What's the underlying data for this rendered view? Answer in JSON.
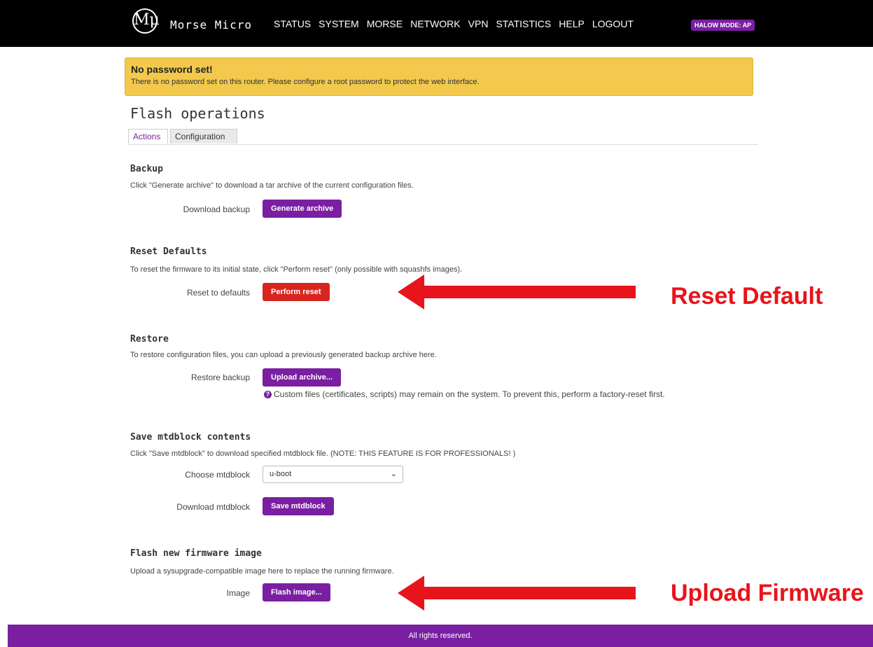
{
  "header": {
    "logo_glyph": "Mμ",
    "brand": "Morse Micro",
    "nav": [
      "STATUS",
      "SYSTEM",
      "MORSE",
      "NETWORK",
      "VPN",
      "STATISTICS",
      "HELP",
      "LOGOUT"
    ],
    "mode_badge": "HALOW MODE: AP"
  },
  "alert": {
    "title": "No password set!",
    "text": "There is no password set on this router. Please configure a root password to protect the web interface."
  },
  "page_title": "Flash operations",
  "tabs": [
    {
      "label": "Actions",
      "active": true
    },
    {
      "label": "Configuration",
      "active": false
    }
  ],
  "sections": {
    "backup": {
      "title": "Backup",
      "desc": "Click \"Generate archive\" to download a tar archive of the current configuration files.",
      "label": "Download backup",
      "button": "Generate archive"
    },
    "reset": {
      "title": "Reset Defaults",
      "desc": "To reset the firmware to its initial state, click \"Perform reset\" (only possible with squashfs images).",
      "label": "Reset to defaults",
      "button": "Perform reset"
    },
    "restore": {
      "title": "Restore",
      "desc": "To restore configuration files, you can upload a previously generated backup archive here.",
      "label": "Restore backup",
      "button": "Upload archive...",
      "help": "Custom files (certificates, scripts) may remain on the system. To prevent this, perform a factory-reset first."
    },
    "mtd": {
      "title": "Save mtdblock contents",
      "desc": "Click \"Save mtdblock\" to download specified mtdblock file. (NOTE: THIS FEATURE IS FOR PROFESSIONALS! )",
      "choose_label": "Choose mtdblock",
      "selected": "u-boot",
      "download_label": "Download mtdblock",
      "button": "Save mtdblock"
    },
    "flash": {
      "title": "Flash new firmware image",
      "desc": "Upload a sysupgrade-compatible image here to replace the running firmware.",
      "label": "Image",
      "button": "Flash image..."
    }
  },
  "annotations": {
    "reset": "Reset Default",
    "upload": "Upload Firmware"
  },
  "footer": "All rights reserved.",
  "colors": {
    "accent": "#7a1fa2",
    "danger": "#d7261f",
    "alert_bg": "#f2c94c",
    "annotation": "#e8141b"
  }
}
